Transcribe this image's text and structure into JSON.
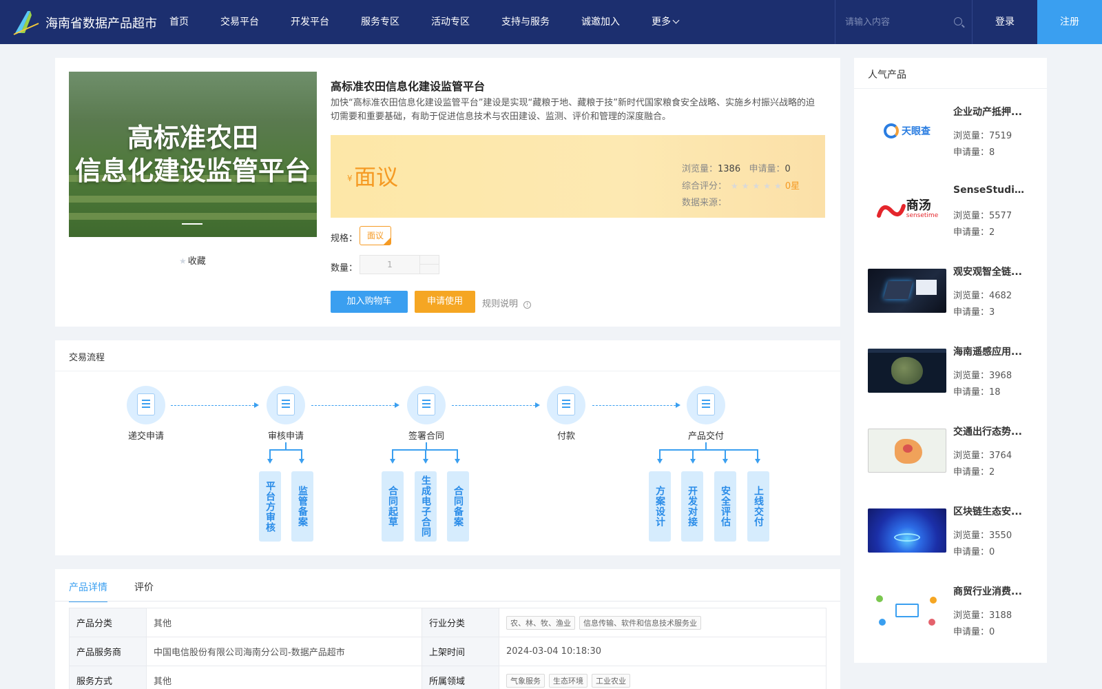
{
  "header": {
    "site_title": "海南省数据产品超市",
    "nav": [
      "首页",
      "交易平台",
      "开发平台",
      "服务专区",
      "活动专区",
      "支持与服务",
      "诚邀加入",
      "更多"
    ],
    "search_placeholder": "请输入内容",
    "login": "登录",
    "register": "注册",
    "brand_color": "#1c2f6f",
    "accent_color": "#3a9ff0"
  },
  "product": {
    "banner_text_line1": "高标准农田",
    "banner_text_line2": "信息化建设监管平台",
    "favorite": "收藏",
    "title": "高标准农田信息化建设监管平台",
    "description": "加快“高标准农田信息化建设监管平台”建设是实现“藏粮于地、藏粮于技”新时代国家粮食安全战略、实施乡村振兴战略的迫切需要和重要基础，有助于促进信息技术与农田建设、监测、评价和管理的深度融合。",
    "currency": "¥",
    "price": "面议",
    "views_label": "浏览量：",
    "views": "1386",
    "applications_label": "申请量：",
    "applications": "0",
    "rating_label": "综合评分：",
    "rating": "0星",
    "rating_stars_filled": 0,
    "rating_stars_total": 5,
    "source_label": "数据来源：",
    "spec_label": "规格：",
    "spec_value": "面议",
    "qty_label": "数量：",
    "qty_value": "1",
    "add_to_cart": "加入购物车",
    "apply": "申请使用",
    "rules": "规则说明",
    "price_color": "#f59a23"
  },
  "flow": {
    "title": "交易流程",
    "steps": [
      "递交申请",
      "审核申请",
      "签署合同",
      "付款",
      "产品交付"
    ],
    "sub_review": [
      "平台方审核",
      "监管备案"
    ],
    "sub_contract": [
      "合同起草",
      "生成电子合同",
      "合同备案"
    ],
    "sub_delivery": [
      "方案设计",
      "开发对接",
      "安全评估",
      "上线交付"
    ]
  },
  "details": {
    "tabs": [
      "产品详情",
      "评价"
    ],
    "rows": [
      {
        "k1": "产品分类",
        "v1": "其他",
        "k2": "行业分类",
        "tags2": [
          "农、林、牧、渔业",
          "信息传输、软件和信息技术服务业"
        ]
      },
      {
        "k1": "产品服务商",
        "v1": "中国电信股份有限公司海南分公司-数据产品超市",
        "k2": "上架时间",
        "v2": "2024-03-04 10:18:30"
      },
      {
        "k1": "服务方式",
        "v1": "其他",
        "k2": "所属领域",
        "tags2": [
          "气象服务",
          "生态环境",
          "工业农业"
        ]
      }
    ]
  },
  "sidebar": {
    "title": "人气产品",
    "views_label": "浏览量：",
    "apps_label": "申请量：",
    "items": [
      {
        "name": "企业动产抵押...",
        "views": "7519",
        "apps": "8",
        "logo_text": "天眼查"
      },
      {
        "name": "SenseStudio...",
        "views": "5577",
        "apps": "2",
        "logo_text": "商汤",
        "logo_sub": "sensetime"
      },
      {
        "name": "观安观智全链...",
        "views": "4682",
        "apps": "3"
      },
      {
        "name": "海南遥感应用...",
        "views": "3968",
        "apps": "18"
      },
      {
        "name": "交通出行态势...",
        "views": "3764",
        "apps": "2"
      },
      {
        "name": "区块链生态安...",
        "views": "3550",
        "apps": "0"
      },
      {
        "name": "商贸行业消费...",
        "views": "3188",
        "apps": "0"
      }
    ]
  }
}
